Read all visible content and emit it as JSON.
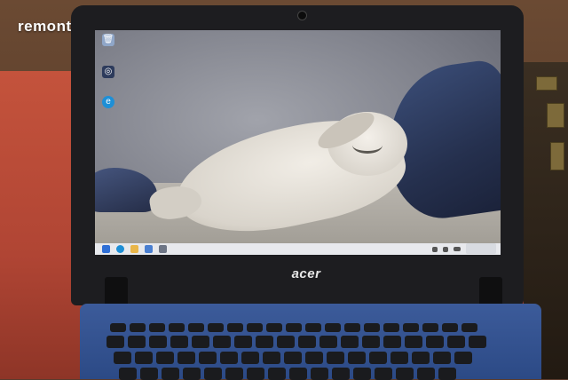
{
  "watermark": {
    "text": "remontpc"
  },
  "laptop": {
    "brand": "acer",
    "colors": {
      "bezel": "#1d1d20",
      "base": "#3c5b9a",
      "keys": "#1a1b1e"
    }
  },
  "desktop": {
    "wallpaper": "seal-on-beach-image",
    "icons": [
      {
        "name": "recycle-bin-icon",
        "label": "Recycle Bin",
        "glyph": "🗑",
        "color": "#8fa6c8"
      },
      {
        "name": "app-shortcut-icon",
        "label": "Shortcut",
        "glyph": "◎",
        "color": "#2d3b5c"
      },
      {
        "name": "edge-browser-icon",
        "label": "Microsoft Edge",
        "glyph": "e",
        "color": "#1e8fd6"
      }
    ]
  },
  "taskbar": {
    "items": [
      {
        "name": "start-icon",
        "color": "#2f6fd6"
      },
      {
        "name": "edge-taskbar-icon",
        "color": "#1e8fd6"
      },
      {
        "name": "explorer-taskbar-icon",
        "color": "#e9b64a"
      },
      {
        "name": "store-taskbar-icon",
        "color": "#4a7fd0"
      },
      {
        "name": "settings-taskbar-icon",
        "color": "#6e7686"
      }
    ],
    "tray_icons": [
      "network-icon",
      "volume-icon",
      "battery-icon"
    ]
  }
}
